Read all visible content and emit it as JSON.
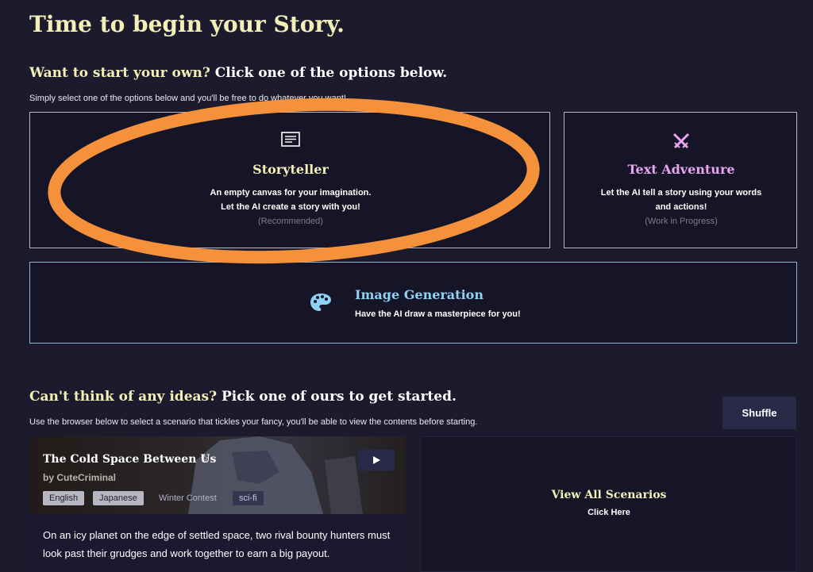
{
  "page": {
    "title": "Time to begin your Story."
  },
  "start_section": {
    "heading_highlight": "Want to start your own?",
    "heading_rest": "Click one of the options below.",
    "subtext": "Simply select one of the options below and you'll be free to do whatever you want!"
  },
  "cards": {
    "storyteller": {
      "icon": "document-icon",
      "title": "Storyteller",
      "line1": "An empty canvas for your imagination.",
      "line2": "Let the AI create a story with you!",
      "note": "(Recommended)",
      "title_color": "#f2f0b6"
    },
    "text_adventure": {
      "icon": "crossed-swords-icon",
      "title": "Text Adventure",
      "line1": "Let the AI tell a story using your words",
      "line2": "and actions!",
      "note": "(Work in Progress)",
      "title_color": "#e9a5f0"
    },
    "image_generation": {
      "icon": "palette-icon",
      "title": "Image Generation",
      "line1": "Have the AI draw a masterpiece for you!",
      "title_color": "#8fd0f5"
    }
  },
  "ideas_section": {
    "heading_highlight": "Can't think of any ideas?",
    "heading_rest": "Pick one of ours to get started.",
    "subtext": "Use the browser below to select a scenario that tickles your fancy, you'll be able to view the contents before starting.",
    "shuffle_label": "Shuffle"
  },
  "scenario": {
    "title": "The Cold Space Between Us",
    "star_icon": "star-outline-icon",
    "author": "by CuteCriminal",
    "tags": [
      "English",
      "Japanese",
      "Winter Contest",
      "sci-fi"
    ],
    "description": "On an icy planet on the edge of settled space, two rival bounty hunters must look past their grudges and work together to earn a big payout.",
    "play_icon": "play-icon"
  },
  "view_all": {
    "title": "View All Scenarios",
    "subtitle": "Click Here"
  },
  "annotation": {
    "color": "#f5913a",
    "shape": "ellipse"
  }
}
